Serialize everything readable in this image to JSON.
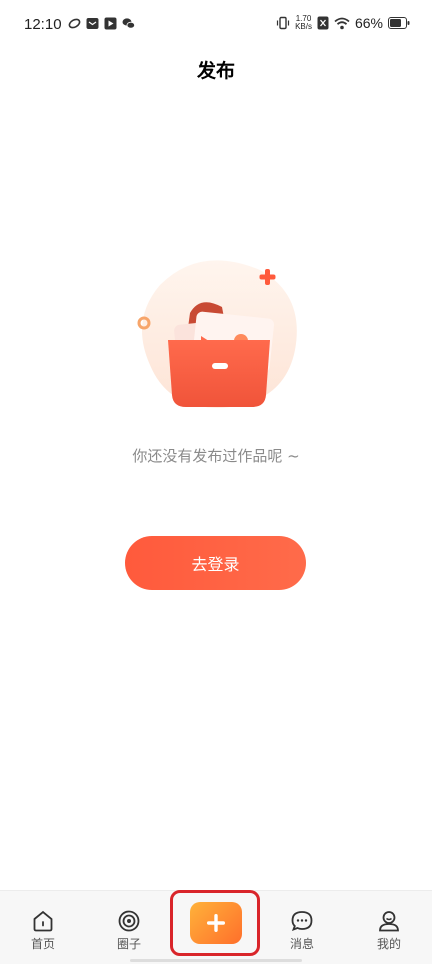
{
  "status_bar": {
    "time": "12:10",
    "net_speed_value": "1.70",
    "net_speed_unit": "KB/s",
    "battery": "66%"
  },
  "header": {
    "title": "发布"
  },
  "empty_state": {
    "message": "你还没有发布过作品呢 ~",
    "illustration": "empty-folder-illustration"
  },
  "login_button": {
    "label": "去登录"
  },
  "tab_bar": {
    "items": [
      {
        "label": "首页",
        "icon": "home-icon"
      },
      {
        "label": "圈子",
        "icon": "circle-target-icon"
      },
      {
        "label": "",
        "icon": "plus-icon"
      },
      {
        "label": "消息",
        "icon": "message-icon"
      },
      {
        "label": "我的",
        "icon": "profile-icon"
      }
    ]
  },
  "colors": {
    "accent": "#ff5a3c",
    "publish_gradient_start": "#ffb23a",
    "publish_gradient_end": "#ff6f2b",
    "highlight_border": "#d9252a"
  }
}
